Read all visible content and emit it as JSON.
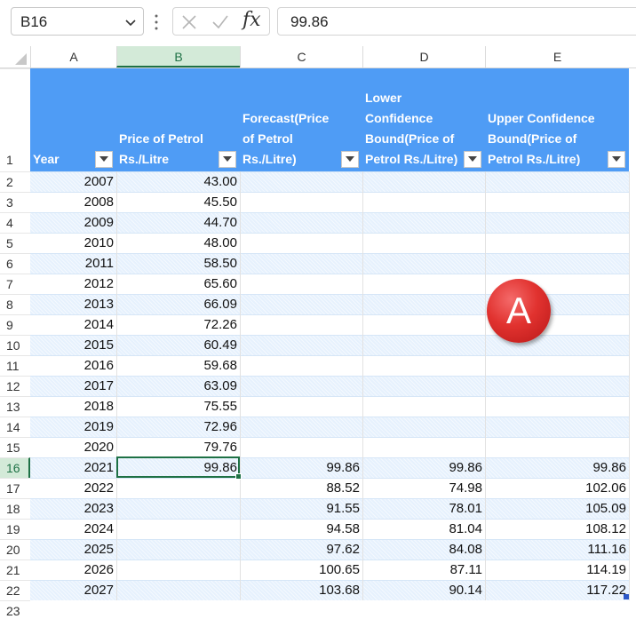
{
  "name_box": {
    "value": "B16"
  },
  "formula_bar": {
    "fx_label": "fx",
    "value": "99.86"
  },
  "columns": [
    "A",
    "B",
    "C",
    "D",
    "E"
  ],
  "rows": [
    "1",
    "2",
    "3",
    "4",
    "5",
    "6",
    "7",
    "8",
    "9",
    "10",
    "11",
    "12",
    "13",
    "14",
    "15",
    "16",
    "17",
    "18",
    "19",
    "20",
    "21",
    "22",
    "23"
  ],
  "table": {
    "headers": [
      "Year",
      "Price of Petrol Rs./Litre",
      "Forecast(Price of Petrol Rs./Litre)",
      "Lower Confidence Bound(Price of Petrol Rs./Litre)",
      "Upper Confidence Bound(Price of Petrol Rs./Litre)"
    ],
    "rows": [
      [
        "2007",
        "43.00",
        "",
        "",
        ""
      ],
      [
        "2008",
        "45.50",
        "",
        "",
        ""
      ],
      [
        "2009",
        "44.70",
        "",
        "",
        ""
      ],
      [
        "2010",
        "48.00",
        "",
        "",
        ""
      ],
      [
        "2011",
        "58.50",
        "",
        "",
        ""
      ],
      [
        "2012",
        "65.60",
        "",
        "",
        ""
      ],
      [
        "2013",
        "66.09",
        "",
        "",
        ""
      ],
      [
        "2014",
        "72.26",
        "",
        "",
        ""
      ],
      [
        "2015",
        "60.49",
        "",
        "",
        ""
      ],
      [
        "2016",
        "59.68",
        "",
        "",
        ""
      ],
      [
        "2017",
        "63.09",
        "",
        "",
        ""
      ],
      [
        "2018",
        "75.55",
        "",
        "",
        ""
      ],
      [
        "2019",
        "72.96",
        "",
        "",
        ""
      ],
      [
        "2020",
        "79.76",
        "",
        "",
        ""
      ],
      [
        "2021",
        "99.86",
        "99.86",
        "99.86",
        "99.86"
      ],
      [
        "2022",
        "",
        "88.52",
        "74.98",
        "102.06"
      ],
      [
        "2023",
        "",
        "91.55",
        "78.01",
        "105.09"
      ],
      [
        "2024",
        "",
        "94.58",
        "81.04",
        "108.12"
      ],
      [
        "2025",
        "",
        "97.62",
        "84.08",
        "111.16"
      ],
      [
        "2026",
        "",
        "100.65",
        "87.11",
        "114.19"
      ],
      [
        "2027",
        "",
        "103.68",
        "90.14",
        "117.22"
      ]
    ]
  },
  "selection": {
    "column": "B",
    "row": "16"
  },
  "badge": {
    "label": "A"
  },
  "colors": {
    "header_bg": "#4f9cf5",
    "band_bg": "#e6f1fd",
    "select_green": "#1e7145",
    "badge_red": "#e1322f"
  }
}
